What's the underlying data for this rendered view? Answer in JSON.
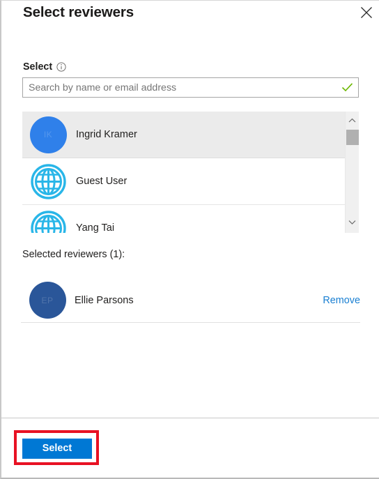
{
  "panel": {
    "title": "Select reviewers",
    "close_icon": "close-icon"
  },
  "field": {
    "label": "Select",
    "info_icon": "info-circle-icon"
  },
  "search": {
    "value": "",
    "placeholder": "Search by name or email address",
    "valid_icon": "check-icon"
  },
  "results": {
    "people": [
      {
        "name": "Ingrid Kramer",
        "avatar_type": "photo",
        "avatar_color": "#2f80ea",
        "initials": "IK",
        "selected": true
      },
      {
        "name": "Guest User",
        "avatar_type": "globe",
        "avatar_color": "#29b6e8",
        "initials": "",
        "selected": false
      },
      {
        "name": "Yang Tai",
        "avatar_type": "globe",
        "avatar_color": "#29b6e8",
        "initials": "",
        "selected": false
      }
    ],
    "scrollbar": {
      "up_icon": "chevron-up-icon",
      "down_icon": "chevron-down-icon"
    }
  },
  "selected": {
    "heading": "Selected reviewers (1):",
    "reviewers": [
      {
        "name": "Ellie Parsons",
        "avatar_type": "photo",
        "avatar_color": "#2a5699",
        "initials": "EP",
        "remove_label": "Remove"
      }
    ]
  },
  "footer": {
    "select_label": "Select"
  },
  "colors": {
    "accent": "#0078d4",
    "link": "#197fd2",
    "highlight_box": "#e81123",
    "row_selected_bg": "#ebebeb",
    "check_green": "#6bb700"
  }
}
